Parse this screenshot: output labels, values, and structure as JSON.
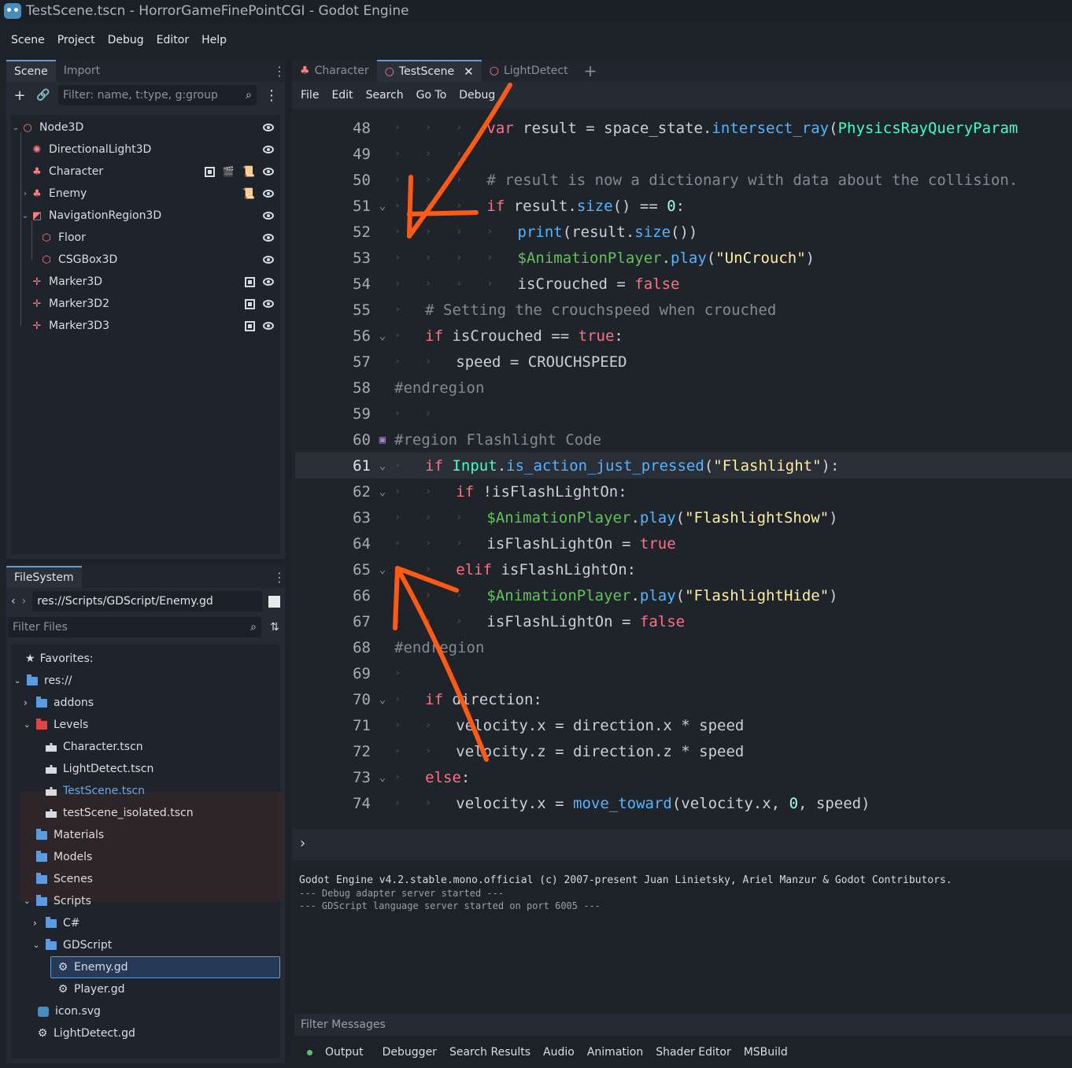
{
  "window": {
    "title": "TestScene.tscn - HorrorGameFinePointCGI - Godot Engine"
  },
  "menubar": [
    "Scene",
    "Project",
    "Debug",
    "Editor",
    "Help"
  ],
  "scene_panel": {
    "tabs": [
      "Scene",
      "Import"
    ],
    "filter_placeholder": "Filter: name, t:type, g:group",
    "nodes": [
      "Node3D",
      "DirectionalLight3D",
      "Character",
      "Enemy",
      "NavigationRegion3D",
      "Floor",
      "CSGBox3D",
      "Marker3D",
      "Marker3D2",
      "Marker3D3"
    ]
  },
  "filesystem": {
    "tab": "FileSystem",
    "path": "res://Scripts/GDScript/Enemy.gd",
    "filter_placeholder": "Filter Files",
    "items": [
      "Favorites:",
      "res://",
      "addons",
      "Levels",
      "Character.tscn",
      "LightDetect.tscn",
      "TestScene.tscn",
      "testScene_isolated.tscn",
      "Materials",
      "Models",
      "Scenes",
      "Scripts",
      "C#",
      "GDScript",
      "Enemy.gd",
      "Player.gd",
      "icon.svg",
      "LightDetect.gd"
    ]
  },
  "editor": {
    "tabs": [
      "Character",
      "TestScene",
      "LightDetect"
    ],
    "menu": [
      "File",
      "Edit",
      "Search",
      "Go To",
      "Debug"
    ]
  },
  "output": {
    "lines": [
      "Godot Engine v4.2.stable.mono.official (c) 2007-present Juan Linietsky, Ariel Manzur & Godot Contributors.",
      "--- Debug adapter server started ---",
      "--- GDScript language server started on port 6005 ---"
    ],
    "filter_placeholder": "Filter Messages"
  },
  "bottom_tabs": [
    "Output",
    "Debugger",
    "Search Results",
    "Audio",
    "Animation",
    "Shader Editor",
    "MSBuild"
  ],
  "colors": {
    "accent": "#6ca8e8",
    "annotation_arrow": "#ff5a14"
  }
}
